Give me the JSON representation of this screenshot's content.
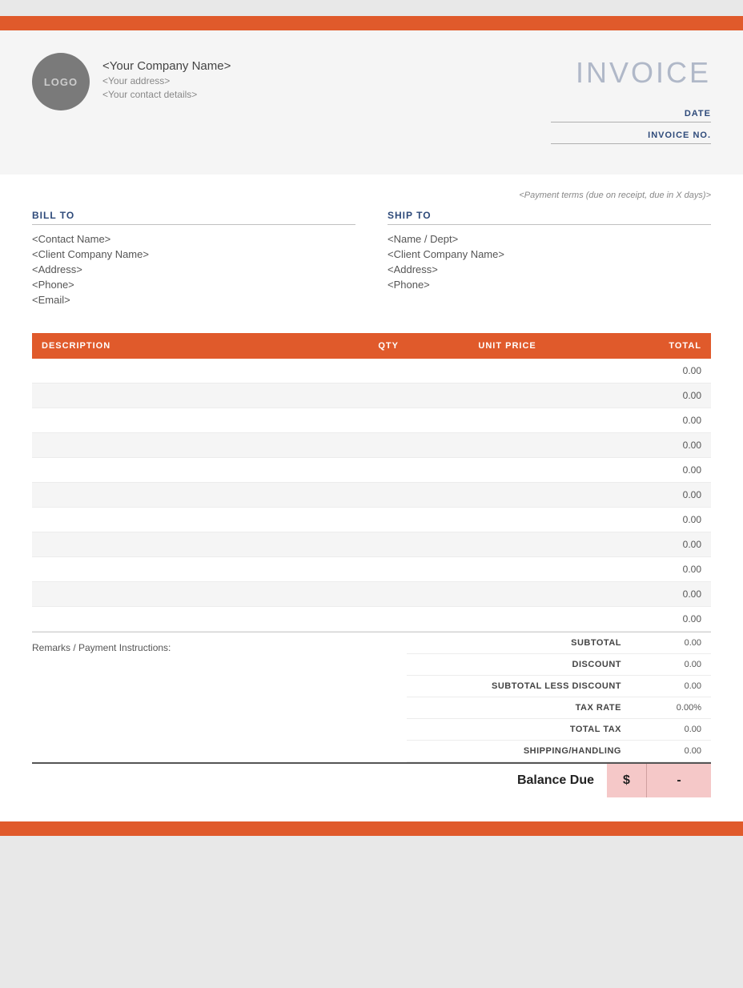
{
  "topBar": {},
  "header": {
    "logo": "LOGO",
    "companyName": "<Your Company Name>",
    "companyAddress": "<Your address>",
    "companyContact": "<Your contact details>",
    "invoiceTitle": "INVOICE",
    "dateLabel": "DATE",
    "invoiceNoLabel": "INVOICE NO."
  },
  "body": {
    "paymentTerms": "<Payment terms (due on receipt, due in X days)>",
    "billTo": {
      "label": "BILL TO",
      "contactName": "<Contact Name>",
      "clientCompany": "<Client Company Name>",
      "address": "<Address>",
      "phone": "<Phone>",
      "email": "<Email>"
    },
    "shipTo": {
      "label": "SHIP TO",
      "nameDept": "<Name / Dept>",
      "clientCompany": "<Client Company Name>",
      "address": "<Address>",
      "phone": "<Phone>"
    }
  },
  "table": {
    "columns": [
      "DESCRIPTION",
      "QTY",
      "UNIT PRICE",
      "TOTAL"
    ],
    "rows": [
      {
        "desc": "",
        "qty": "",
        "unitPrice": "",
        "total": "0.00"
      },
      {
        "desc": "",
        "qty": "",
        "unitPrice": "",
        "total": "0.00"
      },
      {
        "desc": "",
        "qty": "",
        "unitPrice": "",
        "total": "0.00"
      },
      {
        "desc": "",
        "qty": "",
        "unitPrice": "",
        "total": "0.00"
      },
      {
        "desc": "",
        "qty": "",
        "unitPrice": "",
        "total": "0.00"
      },
      {
        "desc": "",
        "qty": "",
        "unitPrice": "",
        "total": "0.00"
      },
      {
        "desc": "",
        "qty": "",
        "unitPrice": "",
        "total": "0.00"
      },
      {
        "desc": "",
        "qty": "",
        "unitPrice": "",
        "total": "0.00"
      },
      {
        "desc": "",
        "qty": "",
        "unitPrice": "",
        "total": "0.00"
      },
      {
        "desc": "",
        "qty": "",
        "unitPrice": "",
        "total": "0.00"
      },
      {
        "desc": "",
        "qty": "",
        "unitPrice": "",
        "total": "0.00"
      }
    ]
  },
  "totals": {
    "remarksLabel": "Remarks / Payment Instructions:",
    "subtotalLabel": "SUBTOTAL",
    "subtotalValue": "0.00",
    "discountLabel": "DISCOUNT",
    "discountValue": "0.00",
    "subtotalLessDiscountLabel": "SUBTOTAL LESS DISCOUNT",
    "subtotalLessDiscountValue": "0.00",
    "taxRateLabel": "TAX RATE",
    "taxRateValue": "0.00%",
    "totalTaxLabel": "TOTAL TAX",
    "totalTaxValue": "0.00",
    "shippingLabel": "SHIPPING/HANDLING",
    "shippingValue": "0.00",
    "balanceDueLabel": "Balance Due",
    "balanceCurrency": "$",
    "balanceValue": "-"
  },
  "colors": {
    "accent": "#e05a2b",
    "headerBg": "#f5f5f5",
    "labelColor": "#2e4a7a",
    "balanceBg": "#f5c8c8"
  }
}
